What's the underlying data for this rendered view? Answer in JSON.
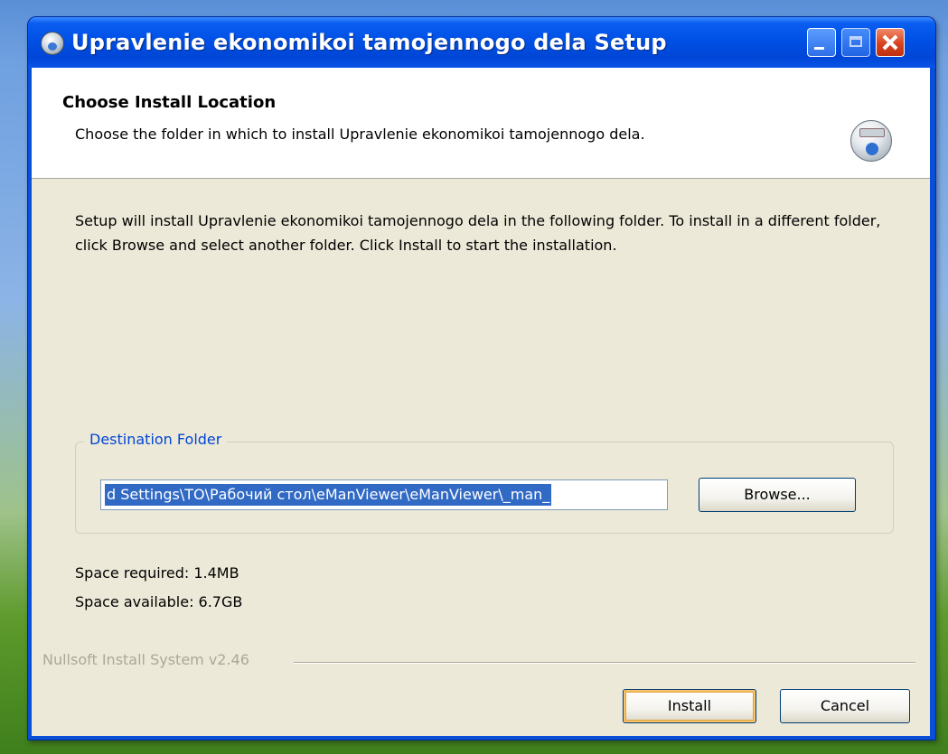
{
  "window": {
    "title": "Upravlenie ekonomikoi tamojennogo dela Setup"
  },
  "header": {
    "title": "Choose Install Location",
    "subtitle": "Choose the folder in which to install Upravlenie ekonomikoi tamojennogo dela."
  },
  "body": {
    "description": "Setup will install Upravlenie ekonomikoi tamojennogo dela in the following folder. To install in a different folder, click Browse and select another folder. Click Install to start the installation."
  },
  "destination": {
    "group_label": "Destination Folder",
    "path_value": "d Settings\\TO\\Рабочий стол\\eManViewer\\eManViewer\\_man_",
    "browse_label": "Browse..."
  },
  "space": {
    "required": "Space required: 1.4MB",
    "available": "Space available: 6.7GB"
  },
  "footer": {
    "branding": "Nullsoft Install System v2.46",
    "install_label": "Install",
    "cancel_label": "Cancel"
  },
  "icons": {
    "title": "installer-globe-icon",
    "header": "install-disk-icon"
  },
  "colors": {
    "titlebar": "#0050e6",
    "client": "#ece9d8",
    "group_label": "#0046d5",
    "selection": "#316ac5"
  }
}
